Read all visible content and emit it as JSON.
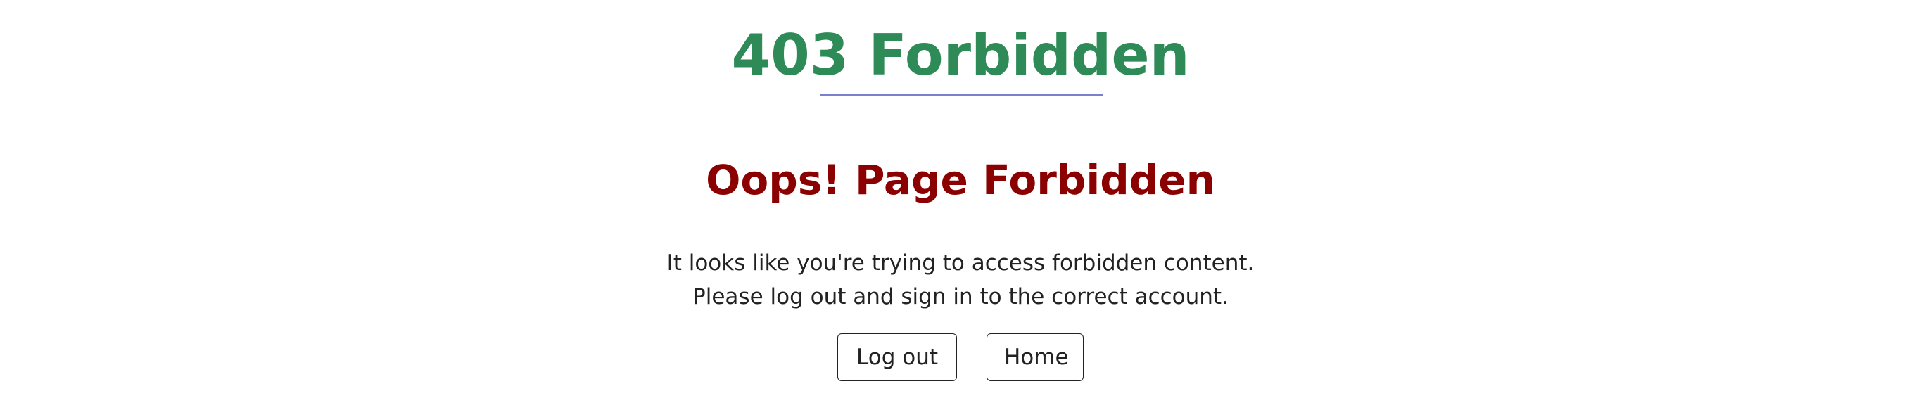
{
  "header": {
    "title": "403 Forbidden"
  },
  "main": {
    "heading": "Oops! Page Forbidden",
    "message_line1": "It looks like you're trying to access forbidden content.",
    "message_line2": "Please log out and sign in to the correct account."
  },
  "actions": {
    "logout_label": "Log out",
    "home_label": "Home"
  },
  "colors": {
    "title": "#2e8b57",
    "underline": "#7b7fcf",
    "heading": "#8b0000",
    "text": "#222222"
  }
}
